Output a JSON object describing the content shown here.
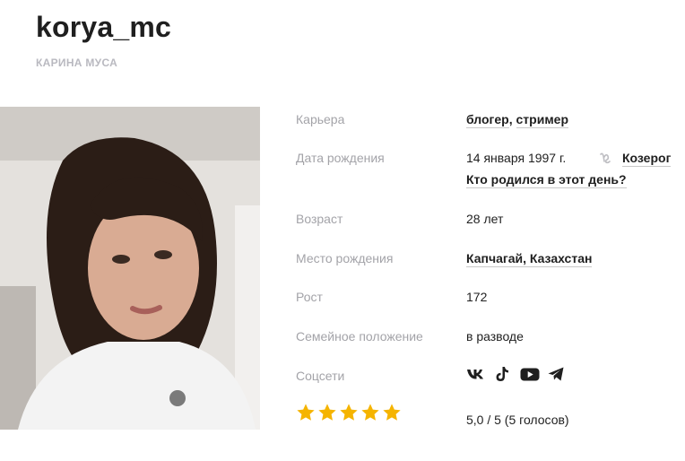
{
  "profile": {
    "nickname": "korya_mc",
    "real_name": "КАРИНА МУСА"
  },
  "details": {
    "career": {
      "label": "Карьера",
      "values": [
        "блогер",
        "стример"
      ]
    },
    "birth_date": {
      "label": "Дата рождения",
      "value": "14 января 1997 г.",
      "zodiac": "Козерог",
      "zodiac_icon": "capricorn-icon",
      "same_day_link": "Кто родился в этот день?"
    },
    "age": {
      "label": "Возраст",
      "value": "28 лет"
    },
    "birthplace": {
      "label": "Место рождения",
      "value": "Капчагай, Казахстан"
    },
    "height": {
      "label": "Рост",
      "value": "172"
    },
    "marital_status": {
      "label": "Семейное положение",
      "value": "в разводе"
    },
    "socials": {
      "label": "Соцсети",
      "icons": [
        "vk-icon",
        "tiktok-icon",
        "youtube-icon",
        "telegram-icon"
      ]
    }
  },
  "rating": {
    "stars": 5,
    "max_stars": 5,
    "text": "5,0 / 5 (5 голосов)",
    "star_color": "#f5b400"
  },
  "colors": {
    "label": "#a3a3a8",
    "text": "#1f1f1f",
    "subtitle": "#b9b9c0"
  }
}
